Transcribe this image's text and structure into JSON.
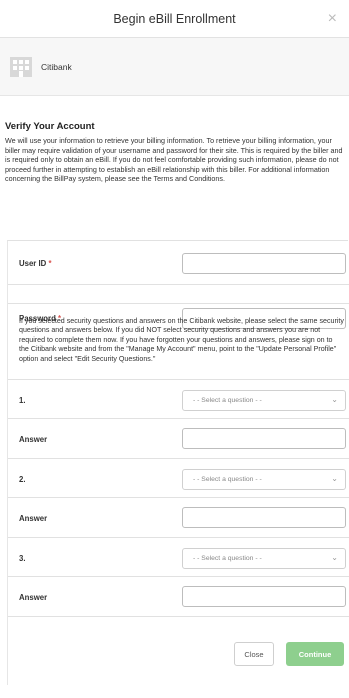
{
  "header": {
    "title": "Begin eBill Enrollment",
    "close_glyph": "×"
  },
  "biller": {
    "name": "Citibank",
    "icon": "bank-icon"
  },
  "verify": {
    "heading": "Verify Your Account",
    "body": "We will use your information to retrieve your billing information. To retrieve your billing information, your biller may require validation of your username and password for their site. This is required by the biller and is required only to obtain an eBill. If you do not feel comfortable providing such information, please do not proceed further in attempting to establish an eBill relationship with this biller. For additional information concerning the BillPay system, please see the Terms and Conditions."
  },
  "form": {
    "user_id_label": "User ID",
    "password_label": "Password",
    "required_mark": "*",
    "security_note": "If you selected security questions and answers on the Citibank website, please select the same security questions and answers below. If you did NOT select security questions and answers you are not required to complete them now. If you have forgotten your questions and answers, please sign on to the Citibank website and from the \"Manage My Account\" menu, point to the \"Update Personal Profile\" option and select \"Edit Security Questions.\"",
    "questions": [
      {
        "number": "1.",
        "placeholder": "- - Select a question - -",
        "answer_label": "Answer"
      },
      {
        "number": "2.",
        "placeholder": "- - Select a question - -",
        "answer_label": "Answer"
      },
      {
        "number": "3.",
        "placeholder": "- - Select a question - -",
        "answer_label": "Answer"
      }
    ]
  },
  "footer": {
    "close_label": "Close",
    "continue_label": "Continue"
  },
  "colors": {
    "continue_bg": "#8ecf8e",
    "required": "#d9534f"
  }
}
